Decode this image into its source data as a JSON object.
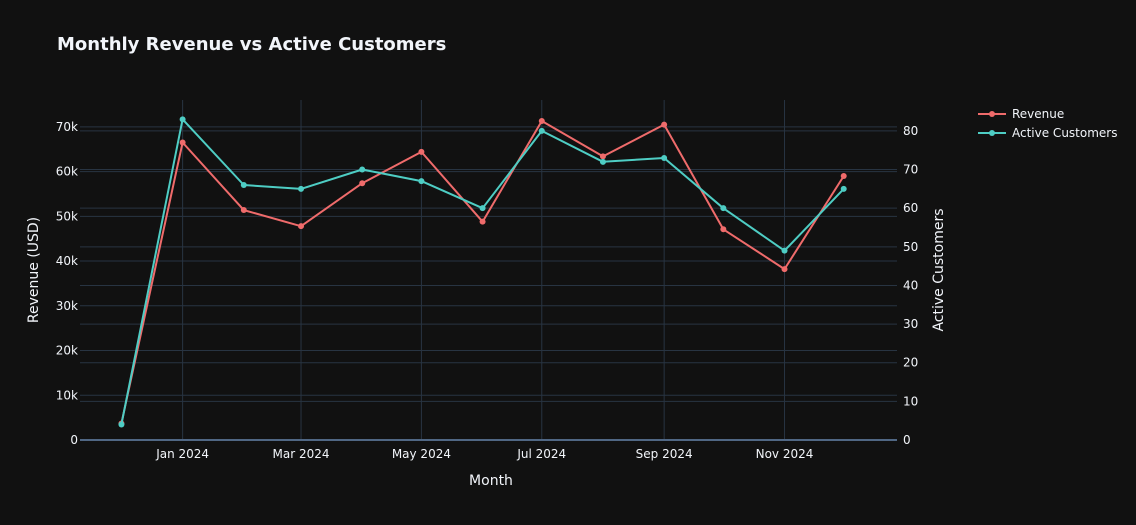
{
  "chart_data": {
    "type": "line",
    "title": "Monthly Revenue vs Active Customers",
    "xlabel": "Month",
    "ylabel": "Revenue (USD)",
    "y2label": "Active Customers",
    "x": [
      "2023-12-01",
      "2024-01-01",
      "2024-02-01",
      "2024-03-01",
      "2024-04-01",
      "2024-05-01",
      "2024-06-01",
      "2024-07-01",
      "2024-08-01",
      "2024-09-01",
      "2024-10-01",
      "2024-11-01",
      "2024-12-01"
    ],
    "x_ticks": [
      "2024-01-01",
      "2024-03-01",
      "2024-05-01",
      "2024-07-01",
      "2024-09-01",
      "2024-11-01"
    ],
    "x_tick_labels": [
      "Jan 2024",
      "Mar 2024",
      "May 2024",
      "Jul 2024",
      "Sep 2024",
      "Nov 2024"
    ],
    "xlim": [
      "2023-11-10",
      "2024-12-28"
    ],
    "ylim": [
      0,
      76000
    ],
    "y_ticks": [
      0,
      10000,
      20000,
      30000,
      40000,
      50000,
      60000,
      70000
    ],
    "y_tick_labels": [
      "0",
      "10k",
      "20k",
      "30k",
      "40k",
      "50k",
      "60k",
      "70k"
    ],
    "y2lim": [
      0,
      88
    ],
    "y2_ticks": [
      0,
      10,
      20,
      30,
      40,
      50,
      60,
      70,
      80
    ],
    "y2_tick_labels": [
      "0",
      "10",
      "20",
      "30",
      "40",
      "50",
      "60",
      "70",
      "80"
    ],
    "series": [
      {
        "name": "Revenue",
        "axis": "left",
        "color": "#ef6b6b",
        "values": [
          3700,
          66500,
          51400,
          47800,
          57400,
          64400,
          48800,
          71300,
          63400,
          70500,
          47100,
          38200,
          59000
        ]
      },
      {
        "name": "Active Customers",
        "axis": "right",
        "color": "#4ecdc4",
        "values": [
          4,
          83,
          66,
          65,
          70,
          67,
          60,
          80,
          72,
          73,
          60,
          49,
          65
        ]
      }
    ],
    "grid": true,
    "legend_position": "top-right",
    "background": "#111111",
    "grid_color": "#283442"
  }
}
